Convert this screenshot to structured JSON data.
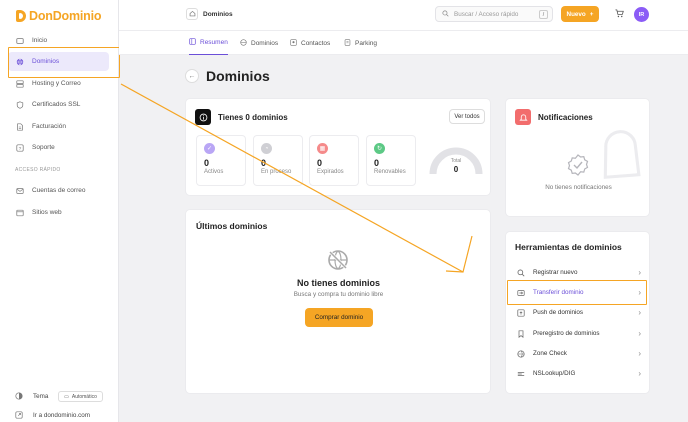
{
  "app": {
    "logo": "DonDominio"
  },
  "sidebar": {
    "items": [
      {
        "label": "Inicio",
        "icon": "home-icon"
      },
      {
        "label": "Dominios",
        "icon": "globe-icon"
      },
      {
        "label": "Hosting y Correo",
        "icon": "server-icon"
      },
      {
        "label": "Certificados SSL",
        "icon": "shield-icon"
      },
      {
        "label": "Facturación",
        "icon": "document-icon"
      },
      {
        "label": "Soporte",
        "icon": "help-icon"
      }
    ],
    "quick_access_label": "ACCESO RÁPIDO",
    "quick_items": [
      {
        "label": "Cuentas de correo",
        "icon": "mail-icon"
      },
      {
        "label": "Sitios web",
        "icon": "window-icon"
      }
    ],
    "theme_label": "Tema",
    "theme_value": "Automático",
    "site_link": "Ir a dondominio.com"
  },
  "topbar": {
    "breadcrumb": "Dominios",
    "search_placeholder": "Buscar / Acceso rápido",
    "search_shortcut": "/",
    "new_button": "Nuevo",
    "avatar_initials": "IR"
  },
  "tabs": [
    {
      "label": "Resumen"
    },
    {
      "label": "Dominios"
    },
    {
      "label": "Contactos"
    },
    {
      "label": "Parking"
    }
  ],
  "page": {
    "title": "Dominios"
  },
  "summary": {
    "title": "Tienes 0 dominios",
    "view_all": "Ver todos",
    "stats": [
      {
        "value": "0",
        "label": "Activos",
        "color": "#b9a6f5"
      },
      {
        "value": "0",
        "label": "En proceso",
        "color": "#cfcfd4"
      },
      {
        "value": "0",
        "label": "Expirados",
        "color": "#f58a8a"
      },
      {
        "value": "0",
        "label": "Renovables",
        "color": "#5cc985"
      }
    ],
    "gauge_label": "Total",
    "gauge_value": "0"
  },
  "notifications": {
    "title": "Notificaciones",
    "empty": "No tienes notificaciones"
  },
  "latest": {
    "title": "Últimos dominios",
    "empty_title": "No tienes dominios",
    "empty_sub": "Busca y compra tu dominio libre",
    "buy_button": "Comprar dominio"
  },
  "tools": {
    "title": "Herramientas de dominios",
    "items": [
      {
        "label": "Registrar nuevo",
        "icon": "search-icon"
      },
      {
        "label": "Transferir dominio",
        "icon": "transfer-icon"
      },
      {
        "label": "Push de dominios",
        "icon": "push-icon"
      },
      {
        "label": "Preregistro de dominios",
        "icon": "bookmark-icon"
      },
      {
        "label": "Zone Check",
        "icon": "zone-icon"
      },
      {
        "label": "NSLookup/DIG",
        "icon": "lookup-icon"
      }
    ]
  },
  "colors": {
    "accent": "#6b4fd8",
    "brand": "#f5a524"
  }
}
